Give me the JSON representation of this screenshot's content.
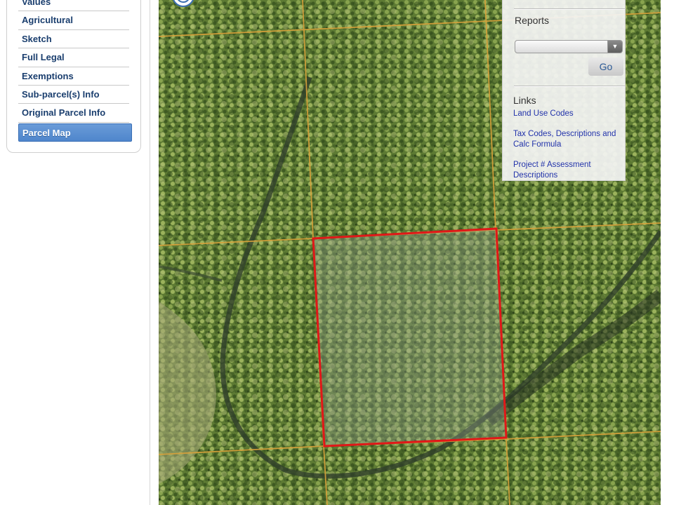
{
  "sidebar": {
    "items": [
      {
        "label": "Values"
      },
      {
        "label": "Agricultural"
      },
      {
        "label": "Sketch"
      },
      {
        "label": "Full Legal"
      },
      {
        "label": "Exemptions"
      },
      {
        "label": "Sub-parcel(s) Info"
      },
      {
        "label": "Original Parcel Info"
      }
    ],
    "active_item": {
      "label": "Parcel Map"
    }
  },
  "reports": {
    "title": "Reports",
    "selected": "",
    "go_label": "Go"
  },
  "links": {
    "title": "Links",
    "items": [
      {
        "label": "Land Use Codes"
      },
      {
        "label": "Tax Codes, Descriptions and Calc Formula"
      },
      {
        "label": "Project # Assessment Descriptions"
      }
    ]
  },
  "colors": {
    "parcel_outline": "#e01818",
    "parcel_grid": "#d9a13a",
    "active_nav": "#4f86cc",
    "link": "#2233aa"
  },
  "icons": [
    "map-navigation-icon",
    "dropdown-arrow-icon"
  ]
}
